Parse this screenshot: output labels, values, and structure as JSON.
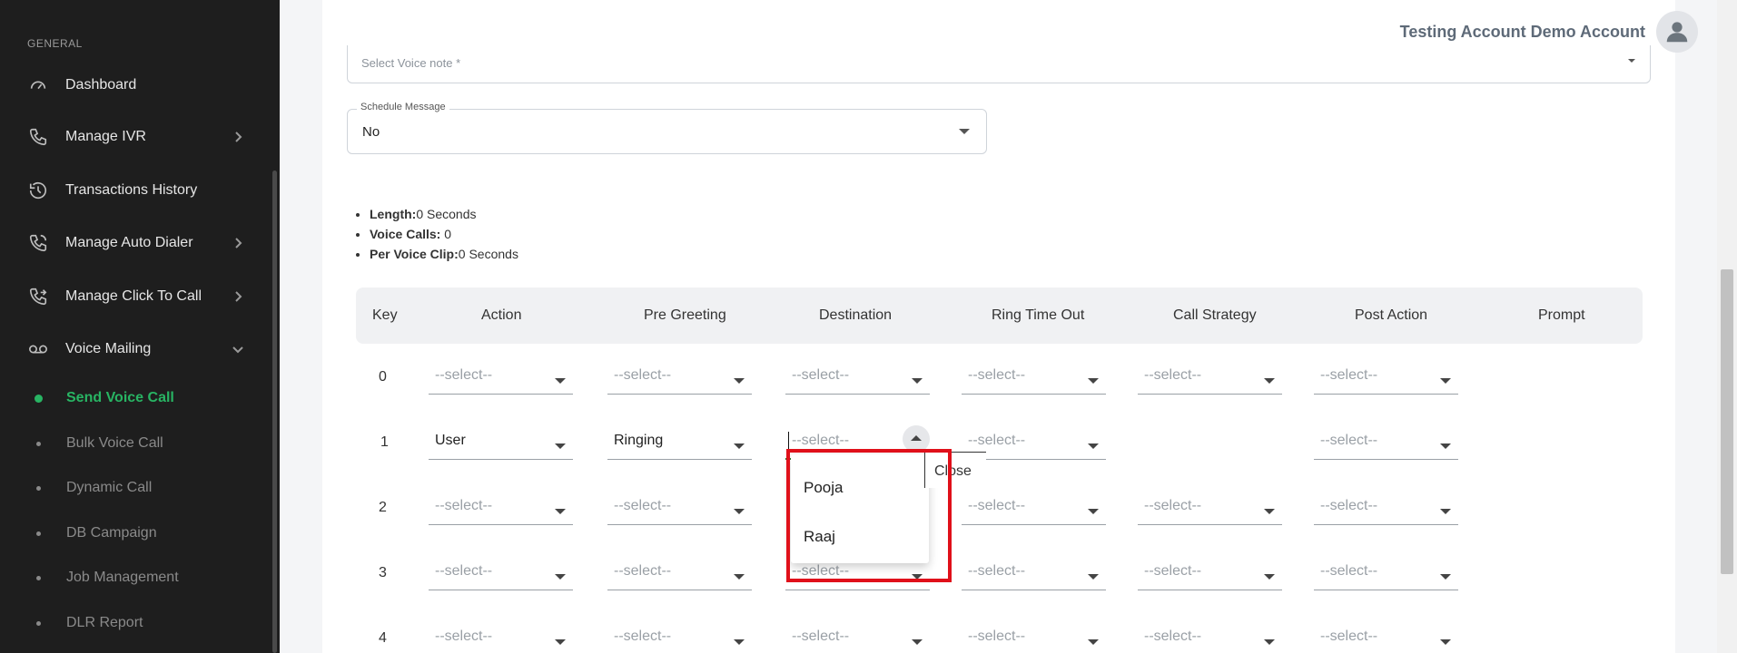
{
  "sidebar": {
    "section_label": "GENERAL",
    "items": [
      {
        "label": "Dashboard"
      },
      {
        "label": "Manage IVR"
      },
      {
        "label": "Transactions History"
      },
      {
        "label": "Manage Auto Dialer"
      },
      {
        "label": "Manage Click To Call"
      },
      {
        "label": "Voice Mailing"
      }
    ],
    "subitems": [
      {
        "label": "Send Voice Call"
      },
      {
        "label": "Bulk Voice Call"
      },
      {
        "label": "Dynamic Call"
      },
      {
        "label": "DB Campaign"
      },
      {
        "label": "Job Management"
      },
      {
        "label": "DLR Report"
      }
    ]
  },
  "header": {
    "user_name": "Testing Account Demo Account"
  },
  "form": {
    "voice_note_placeholder": "Select Voice note *",
    "schedule_label": "Schedule Message",
    "schedule_value": "No"
  },
  "stats": {
    "length_label": "Length:",
    "length_value": "0 Seconds",
    "calls_label": "Voice Calls:",
    "calls_value": " 0",
    "clip_label": "Per Voice Clip:",
    "clip_value": "0 Seconds"
  },
  "table": {
    "headers": [
      "Key",
      "Action",
      "Pre Greeting",
      "Destination",
      "Ring Time Out",
      "Call Strategy",
      "Post Action",
      "Prompt"
    ],
    "placeholder": "--select--",
    "rows": [
      {
        "key": "0",
        "action": "--select--",
        "pre": "--select--",
        "dest": "--select--",
        "ring": "--select--",
        "strategy": "--select--",
        "post": "--select--"
      },
      {
        "key": "1",
        "action": "User",
        "pre": "Ringing",
        "dest": "--select--",
        "ring": "--select--",
        "strategy": "",
        "post": "--select--"
      },
      {
        "key": "2",
        "action": "--select--",
        "pre": "--select--",
        "dest": "--select--",
        "ring": "--select--",
        "strategy": "--select--",
        "post": "--select--"
      },
      {
        "key": "3",
        "action": "--select--",
        "pre": "--select--",
        "dest": "--select--",
        "ring": "--select--",
        "strategy": "--select--",
        "post": "--select--"
      },
      {
        "key": "4",
        "action": "--select--",
        "pre": "--select--",
        "dest": "--select--",
        "ring": "--select--",
        "strategy": "--select--",
        "post": "--select--"
      }
    ]
  },
  "dropdown": {
    "options": [
      "Pooja",
      "Raaj"
    ],
    "close_label": "Close"
  },
  "colors": {
    "accent": "#28b463",
    "highlight": "#e0101a",
    "sidebar_bg": "#1e1e1e"
  }
}
